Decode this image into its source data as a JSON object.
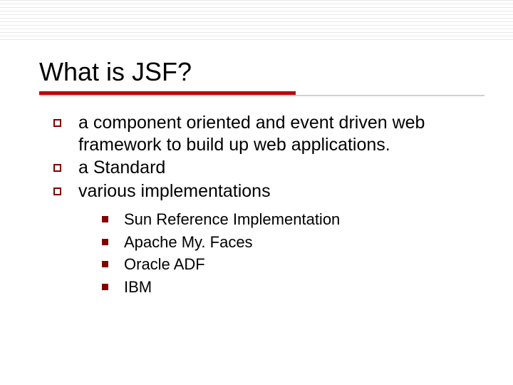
{
  "slide": {
    "title": "What is JSF?",
    "bullets": [
      "a component oriented and event driven web framework to build up web applications.",
      "a Standard",
      "various implementations"
    ],
    "subbullets": [
      "Sun Reference Implementation",
      "Apache My. Faces",
      "Oracle ADF",
      "IBM"
    ]
  }
}
